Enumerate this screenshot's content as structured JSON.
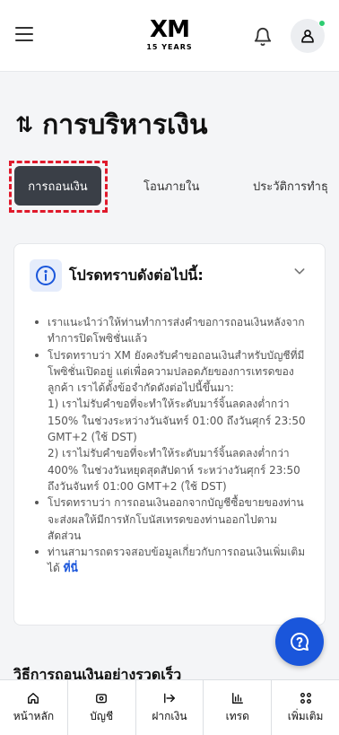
{
  "header": {
    "logo_main": "XM",
    "logo_sub": "15 YEARS"
  },
  "page": {
    "title": "การบริหารเงิน"
  },
  "tabs": [
    {
      "label": "การถอนเงิน",
      "active": true
    },
    {
      "label": "โอนภายใน",
      "active": false
    },
    {
      "label": "ประวัติการทำธุ",
      "active": false
    }
  ],
  "notice": {
    "title": "โปรดทราบดังต่อไปนี้:",
    "items": [
      "เราแนะนำว่าให้ท่านทำการส่งคำขอการถอนเงินหลังจากทำการปิดโพซิชั่นแล้ว",
      "โปรดทราบว่า XM ยังคงรับคำขอถอนเงินสำหรับบัญชีที่มีโพซิชั่นเปิดอยู่ แต่เพื่อความปลอดภัยของการเทรดของลูกค้า เราได้ตั้งข้อจำกัดดังต่อไปนี้ขึ้นมา:",
      "1) เราไม่รับคำขอที่จะทำให้ระดับมาร์จิ้นลดลงต่ำกว่า 150% ในช่วงระหว่างวันจันทร์ 01:00 ถึงวันศุกร์ 23:50 GMT+2 (ใช้ DST)",
      "2) เราไม่รับคำขอที่จะทำให้ระดับมาร์จิ้นลดลงต่ำกว่า 400% ในช่วงวันหยุดสุดสัปดาห์ ระหว่างวันศุกร์ 23:50 ถึงวันจันทร์ 01:00 GMT+2 (ใช้ DST)",
      "โปรดทราบว่า การถอนเงินออกจากบัญชีซื้อขายของท่านจะส่งผลให้มีการหักโบนัสเทรดของท่านออกไปตามสัดส่วน",
      "ท่านสามารถตรวจสอบข้อมูลเกี่ยวกับการถอนเงินเพิ่มเติมได้"
    ],
    "link_label": "ที่นี่"
  },
  "section": {
    "heading": "วิธีการถอนเงินอย่างรวดเร็ว"
  },
  "bottom_nav": [
    {
      "label": "หน้าหลัก",
      "icon": "home-icon"
    },
    {
      "label": "บัญชี",
      "icon": "wallet-icon"
    },
    {
      "label": "ฝากเงิน",
      "icon": "deposit-icon"
    },
    {
      "label": "เทรด",
      "icon": "chart-icon"
    },
    {
      "label": "เพิ่มเติม",
      "icon": "grid-icon"
    }
  ],
  "colors": {
    "brand_red": "#d9001b",
    "accent_blue": "#1a56db",
    "active_tab_bg": "#3a3f47"
  }
}
